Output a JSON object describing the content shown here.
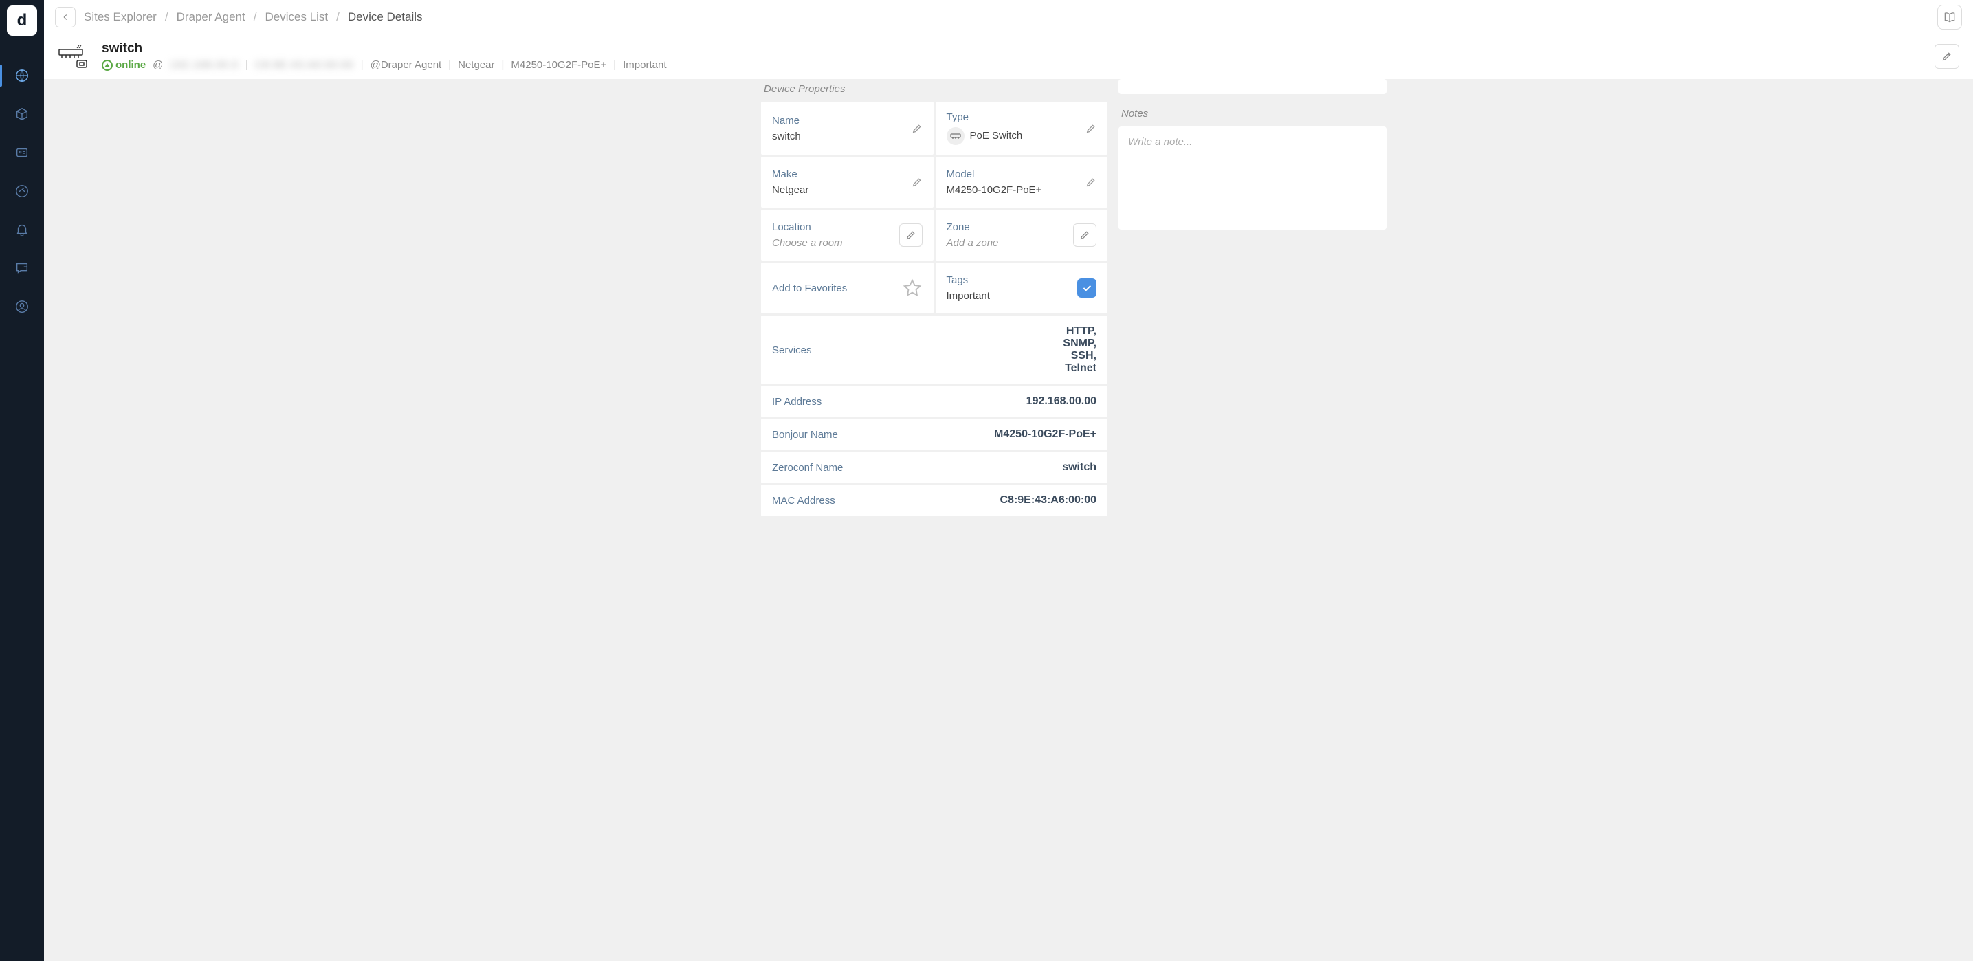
{
  "sidebar": {
    "logo_letter": "d"
  },
  "breadcrumb": {
    "items": [
      "Sites Explorer",
      "Draper Agent",
      "Devices List"
    ],
    "current": "Device Details"
  },
  "header": {
    "title": "switch",
    "status": "online",
    "at": "@",
    "blurred1": "192.168.00.0",
    "blurred2": "C8:9E:43:A6:00:00",
    "agent_prefix": "@",
    "agent_name": "Draper Agent",
    "make": "Netgear",
    "model": "M4250-10G2F-PoE+",
    "tag": "Important"
  },
  "properties": {
    "heading": "Device Properties",
    "name_label": "Name",
    "name_value": "switch",
    "type_label": "Type",
    "type_value": "PoE Switch",
    "make_label": "Make",
    "make_value": "Netgear",
    "model_label": "Model",
    "model_value": "M4250-10G2F-PoE+",
    "location_label": "Location",
    "location_placeholder": "Choose a room",
    "zone_label": "Zone",
    "zone_placeholder": "Add a zone",
    "favorites_label": "Add to Favorites",
    "tags_label": "Tags",
    "tags_value": "Important"
  },
  "details": {
    "services_label": "Services",
    "services_value": "HTTP,\nSNMP,\nSSH,\nTelnet",
    "ip_label": "IP Address",
    "ip_value": "192.168.00.00",
    "bonjour_label": "Bonjour Name",
    "bonjour_value": "M4250-10G2F-PoE+",
    "zeroconf_label": "Zeroconf Name",
    "zeroconf_value": "switch",
    "mac_label": "MAC Address",
    "mac_value": "C8:9E:43:A6:00:00"
  },
  "notes": {
    "heading": "Notes",
    "placeholder": "Write a note..."
  }
}
